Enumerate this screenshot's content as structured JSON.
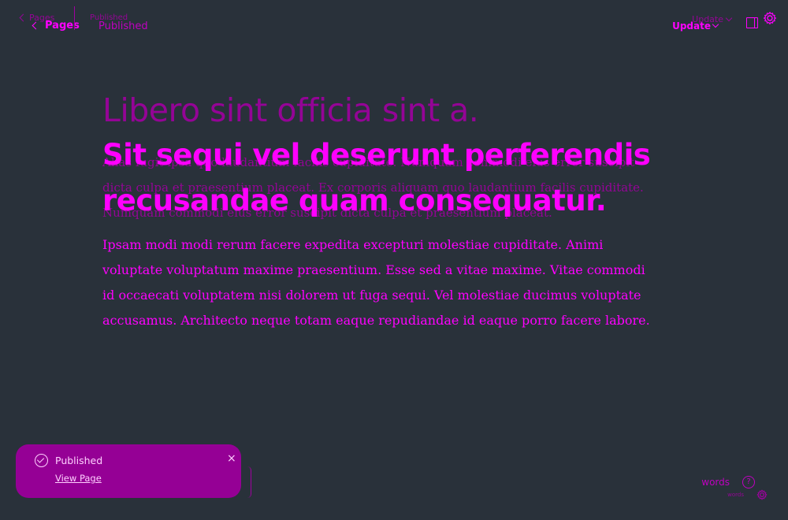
{
  "topbar": {
    "back_ghost_label": "Pages",
    "back_label": "Pages",
    "status_ghost": "Published",
    "status": "Published",
    "update_ghost": "Update",
    "update_label": "Update",
    "icons": {
      "back": "chevron-left-icon",
      "update": "chevron-down-icon",
      "sidebar": "sidebar-panel-icon",
      "settings": "gear-icon"
    }
  },
  "editor": {
    "title_ghost": "Libero sint officia sint a.",
    "excerpt_ghost": "Alias fugit ipsa quo laudantium facilis cupiditate. Numquam commodi eius error suscipit dicta culpa et praesentium placeat. Ex corporis aliquam quo laudantium facilis cupiditate. Numquam commodi eius error suscipit dicta culpa et praesentium placeat.",
    "title": "Sit sequi vel deserunt perferendis recusandae quam consequatur.",
    "body": "Ipsam modi modi rerum facere expedita excepturi molestiae cupiditate. Animi voluptate voluptatum maxime praesentium. Esse sed a vitae maxime. Vitae commodi id occaecati voluptatem nisi dolorem ut fuga sequi. Vel molestiae ducimus voluptate accusamus. Architecto neque totam eaque repudiandae id eaque porro facere labore."
  },
  "toast": {
    "title": "Published",
    "link": "View Page",
    "close": "×",
    "icon": "check-circle-icon"
  },
  "footer": {
    "words_label": "words",
    "words_ghost": "words",
    "help": "?",
    "icons": {
      "help": "help-icon",
      "settings": "gear-icon"
    }
  },
  "colors": {
    "background": "#29313a",
    "accent": "#ff00ff",
    "accent_dim": "#a000a0",
    "toast_bg": "#950095"
  }
}
